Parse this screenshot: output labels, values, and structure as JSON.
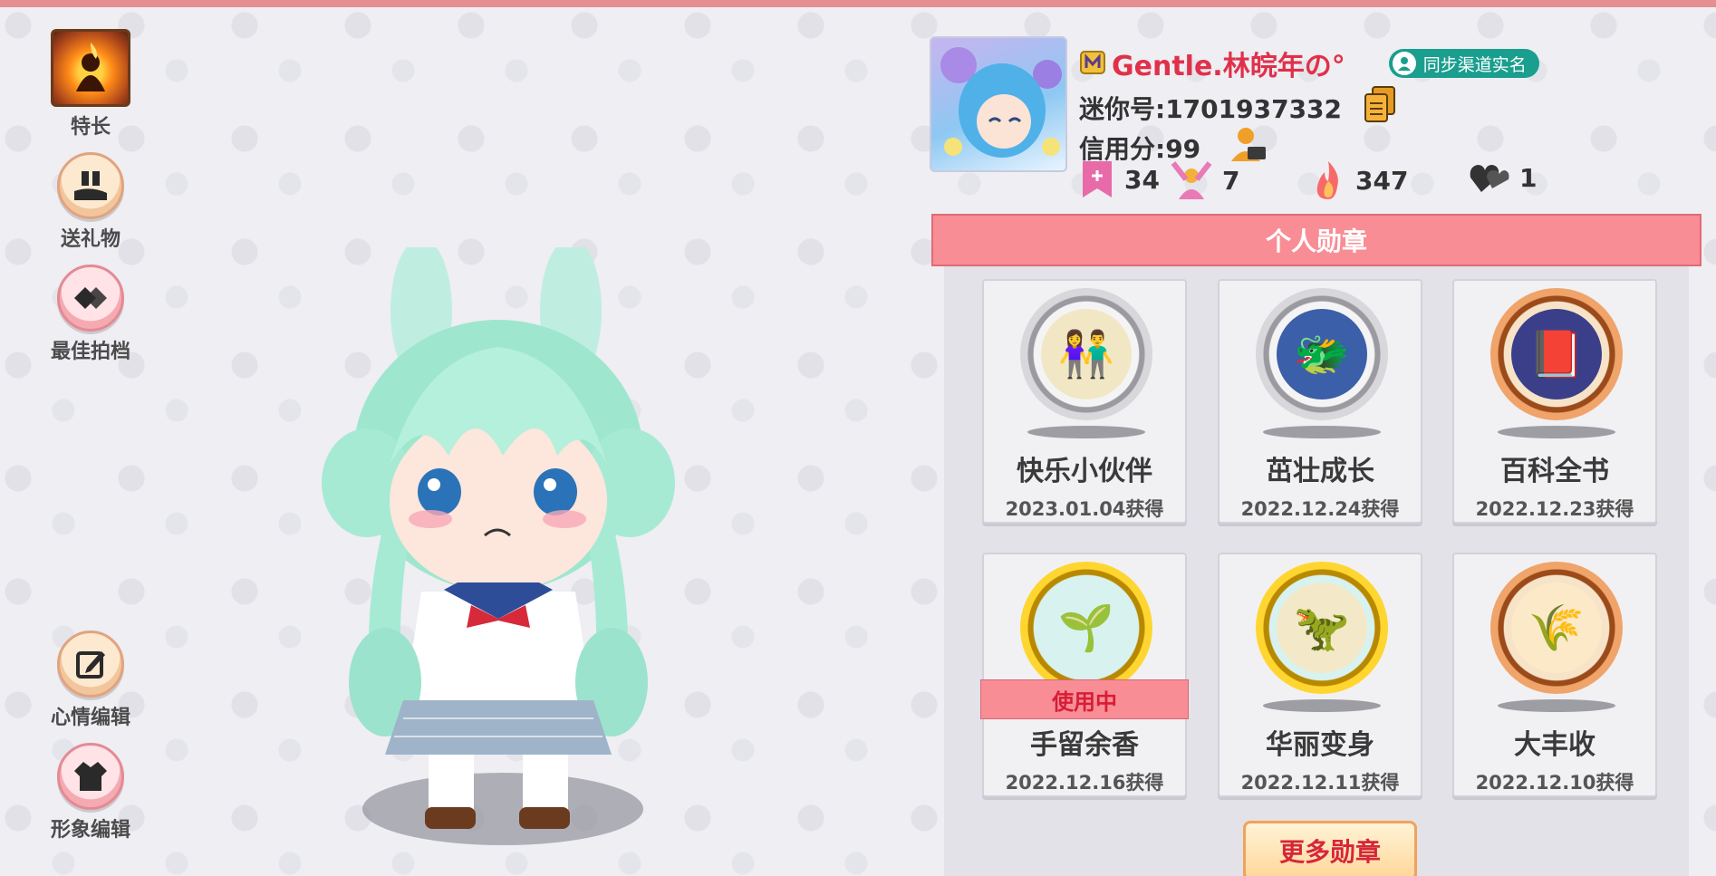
{
  "left_menu": {
    "specialty": "特长",
    "gift": "送礼物",
    "best_partner": "最佳拍档",
    "mood_edit": "心情编辑",
    "appearance_edit": "形象编辑"
  },
  "profile": {
    "name": "Gentle.林皖年の°",
    "verify_label": "同步渠道实名",
    "mini_id": "迷你号:1701937332",
    "credit": "信用分:99",
    "stats": {
      "bookmark": "34",
      "fans": "7",
      "flame": "347",
      "hearts": "1"
    }
  },
  "medals_panel": {
    "title": "个人勋章",
    "items": [
      {
        "name": "快乐小伙伴",
        "date": "2023.01.04获得",
        "tier": "silver",
        "icon": "friends-medal-icon"
      },
      {
        "name": "茁壮成长",
        "date": "2022.12.24获得",
        "tier": "silver",
        "icon": "dragon-king-medal-icon"
      },
      {
        "name": "百科全书",
        "date": "2022.12.23获得",
        "tier": "bronze",
        "icon": "book-medal-icon"
      },
      {
        "name": "手留余香",
        "date": "2022.12.16获得",
        "tier": "gold",
        "icon": "sprout-medal-icon",
        "badge": "使用中"
      },
      {
        "name": "华丽变身",
        "date": "2022.12.11获得",
        "tier": "gold",
        "icon": "dino-medal-icon"
      },
      {
        "name": "大丰收",
        "date": "2022.12.10获得",
        "tier": "bronze",
        "icon": "harvest-medal-icon"
      }
    ],
    "more_label": "更多勋章"
  },
  "colors": {
    "accent_pink": "#f88d96",
    "name_red": "#e0314a",
    "verify_teal": "#1a9e8e"
  }
}
